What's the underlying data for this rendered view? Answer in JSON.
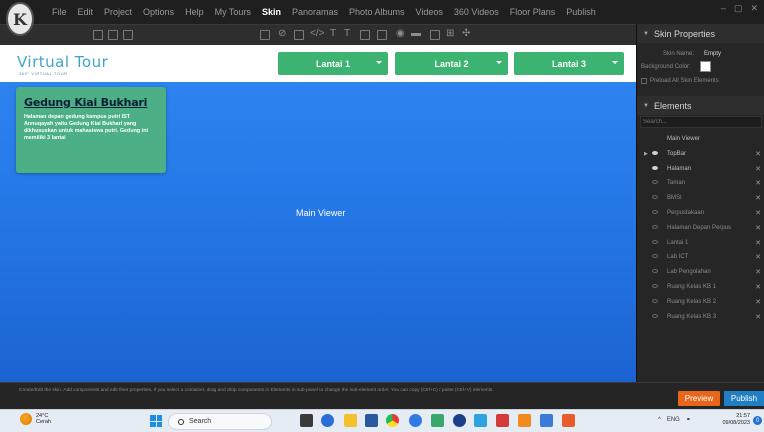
{
  "menubar": {
    "logo_letter": "K",
    "items": [
      "File",
      "Edit",
      "Project",
      "Options",
      "Help",
      "My Tours",
      "Skin",
      "Panoramas",
      "Photo Albums",
      "Videos",
      "360 Videos",
      "Floor Plans",
      "Publish"
    ],
    "active": "Skin",
    "window_controls": [
      "–",
      "▢",
      "✕"
    ]
  },
  "viewer": {
    "logo_text": "Virtual Tour",
    "logo_subtitle": "360° VIRTUAL TOUR",
    "floors": [
      "Lantai 1",
      "Lantai 2",
      "Lantai 3"
    ],
    "info_title": "Gedung Kiai Bukhari",
    "info_body": "Halaman depan gedung kampus putri IST Annuqayah yaitu Gedung Kiai Bukhari yang dikhususkan untuk mahasiswa putri. Gedung ini memiliki 3 lantai",
    "center_label": "Main Viewer",
    "colors": {
      "background": "#2577e6",
      "topbar": "#ffffff",
      "button": "#3cb371",
      "card": "#4caf86"
    }
  },
  "panel": {
    "skin_properties_title": "Skin Properties",
    "skin_name_label": "Skin Name:",
    "skin_name_value": "Empty",
    "background_color_label": "Background Color:",
    "background_color_value": "#ffffff",
    "preload_label": "Preload All Skin Elements",
    "elements_title": "Elements",
    "search_placeholder": "Search...",
    "elements": [
      {
        "label": "Main Viewer",
        "arrow": "",
        "eye": "none",
        "bright": true,
        "close": false
      },
      {
        "label": "TopBar",
        "arrow": "▶",
        "eye": "on",
        "bright": true,
        "close": true
      },
      {
        "label": "Halaman",
        "arrow": "",
        "eye": "on",
        "bright": true,
        "close": true
      },
      {
        "label": "Taman",
        "arrow": "",
        "eye": "off",
        "bright": false,
        "close": true
      },
      {
        "label": "BMSI",
        "arrow": "",
        "eye": "off",
        "bright": false,
        "close": true
      },
      {
        "label": "Perpustakaan",
        "arrow": "",
        "eye": "off",
        "bright": false,
        "close": true
      },
      {
        "label": "Halaman Depan Perpus",
        "arrow": "",
        "eye": "off",
        "bright": false,
        "close": true
      },
      {
        "label": "Lantai 1",
        "arrow": "",
        "eye": "off",
        "bright": false,
        "close": true
      },
      {
        "label": "Lab ICT",
        "arrow": "",
        "eye": "off",
        "bright": false,
        "close": true
      },
      {
        "label": "Lab Pengolahan",
        "arrow": "",
        "eye": "off",
        "bright": false,
        "close": true
      },
      {
        "label": "Ruang Kelas KB 1",
        "arrow": "",
        "eye": "off",
        "bright": false,
        "close": true
      },
      {
        "label": "Ruang Kelas KB 2",
        "arrow": "",
        "eye": "off",
        "bright": false,
        "close": true
      },
      {
        "label": "Ruang Kelas KB 3",
        "arrow": "",
        "eye": "off",
        "bright": false,
        "close": true
      }
    ]
  },
  "statusbar": {
    "help_text": "Create/Edit the skin. Add components and edit their properties. If you select a container, drag and drop components in Elements in sub-panel to change the sub-element order. You can copy (Ctrl+C) / paste (Ctrl+V) elements.",
    "preview_label": "Preview",
    "publish_label": "Publish"
  },
  "taskbar": {
    "temperature": "24°C",
    "weather": "Cerah",
    "search_label": "Search",
    "tray_lang": "ENG",
    "time": "21:57",
    "date": "09/08/2023",
    "notification_count": "0"
  }
}
